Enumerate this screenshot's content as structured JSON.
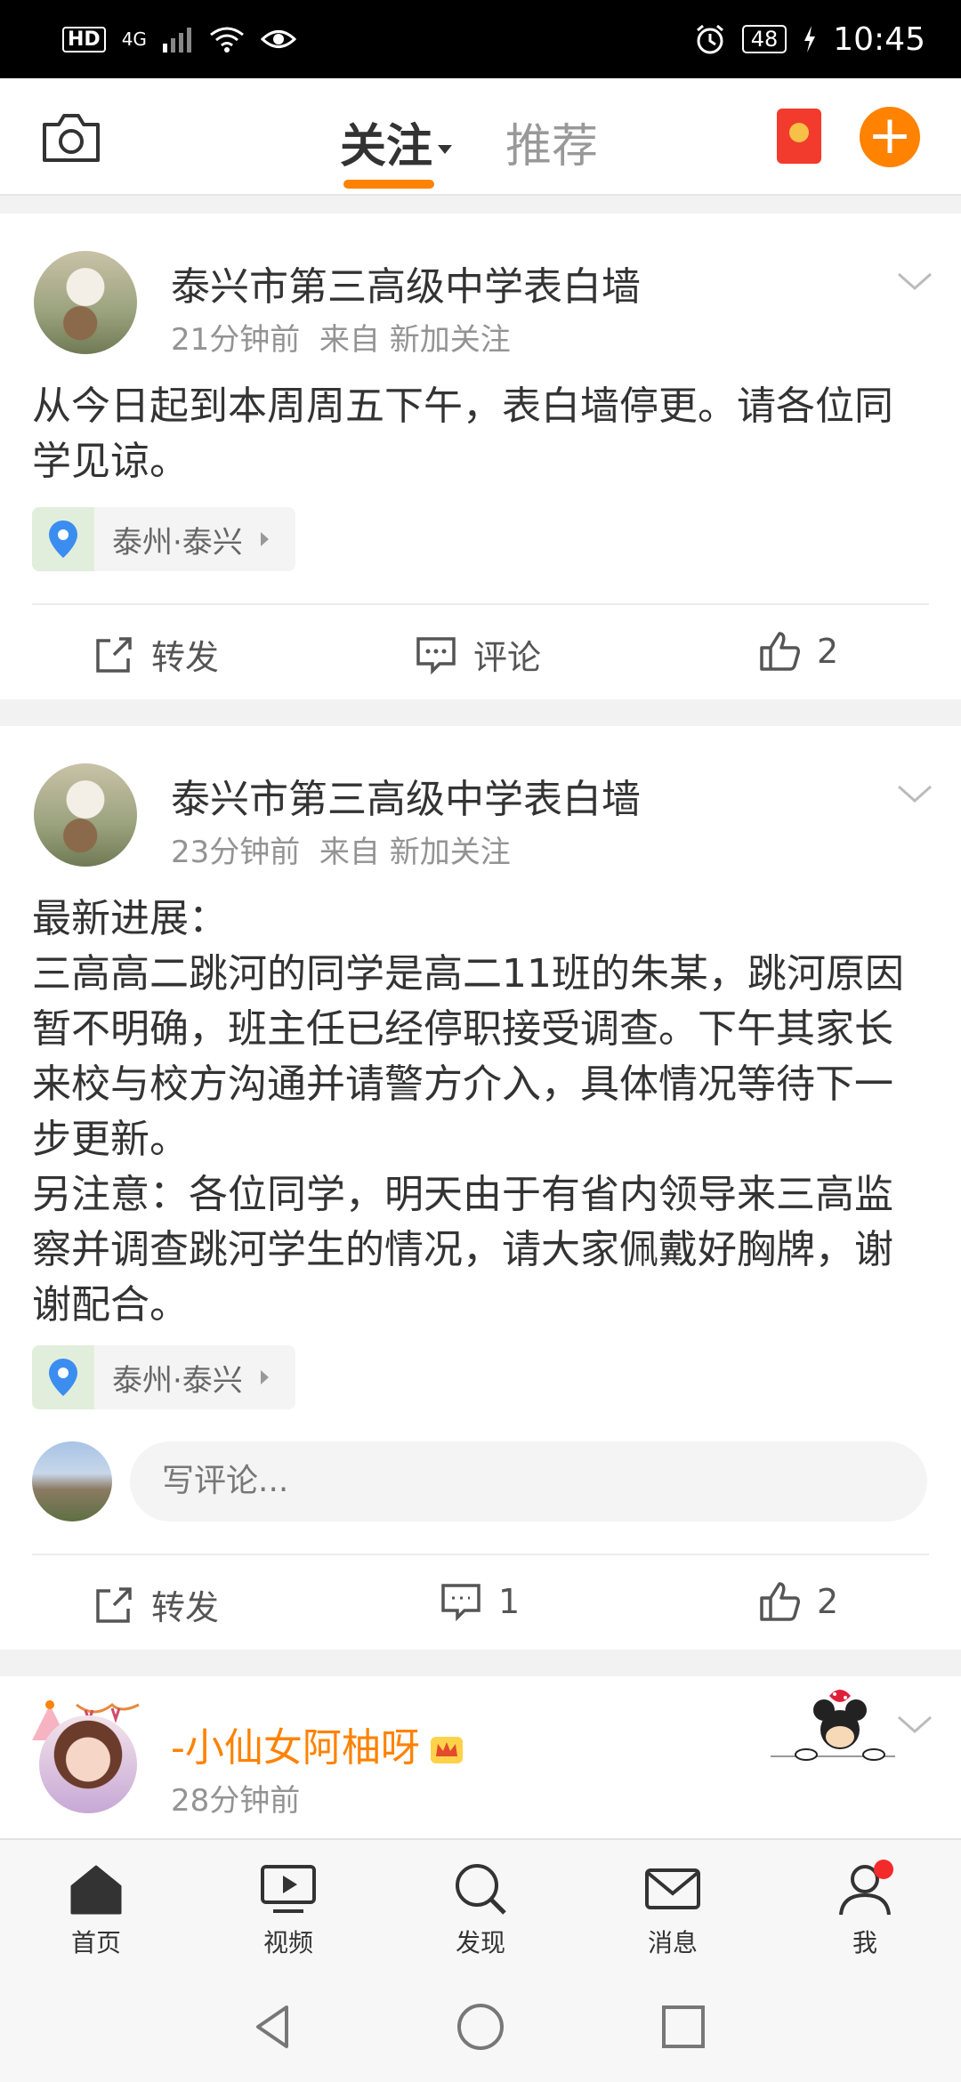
{
  "status_bar": {
    "hd": "HD",
    "network": "4G",
    "battery": "48",
    "time": "10:45"
  },
  "top_nav": {
    "tabs": [
      {
        "label": "关注",
        "active": true
      },
      {
        "label": "推荐",
        "active": false
      }
    ],
    "accent_color": "#ff8200"
  },
  "posts": [
    {
      "author": "泰兴市第三高级中学表白墙",
      "time": "21分钟前",
      "source": "来自 新加关注",
      "text": "从今日起到本周周五下午，表白墙停更。请各位同学见谅。",
      "location": "泰州·泰兴",
      "actions": {
        "repost": "转发",
        "comment": "评论",
        "like_count": "2"
      }
    },
    {
      "author": "泰兴市第三高级中学表白墙",
      "time": "23分钟前",
      "source": "来自 新加关注",
      "text": "最新进展：\n三高高二跳河的同学是高二11班的朱某，跳河原因暂不明确，班主任已经停职接受调查。下午其家长来校与校方沟通并请警方介入，具体情况等待下一步更新。\n另注意：各位同学，明天由于有省内领导来三高监察并调查跳河学生的情况，请大家佩戴好胸牌，谢谢配合。",
      "location": "泰州·泰兴",
      "comment_placeholder": "写评论...",
      "actions": {
        "repost": "转发",
        "comment_count": "1",
        "like_count": "2"
      }
    },
    {
      "author": "-小仙女阿柚呀",
      "time": "28分钟前"
    }
  ],
  "tab_bar": {
    "items": [
      {
        "label": "首页",
        "icon": "home-icon"
      },
      {
        "label": "视频",
        "icon": "video-icon"
      },
      {
        "label": "发现",
        "icon": "search-icon"
      },
      {
        "label": "消息",
        "icon": "mail-icon"
      },
      {
        "label": "我",
        "icon": "profile-icon"
      }
    ]
  }
}
